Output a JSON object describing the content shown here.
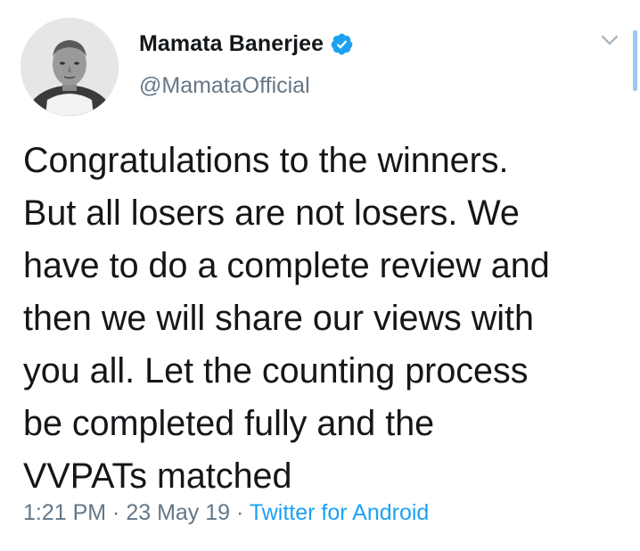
{
  "user": {
    "display_name": "Mamata Banerjee",
    "handle": "@MamataOfficial",
    "verified": true
  },
  "tweet": {
    "lines": [
      "Congratulations to the winners.",
      "But all losers are not losers. We",
      "have to do a complete review and",
      "then we will share our views with",
      "you all. Let the counting process",
      "be completed fully and the",
      "VVPATs matched"
    ]
  },
  "meta": {
    "time": "1:21 PM",
    "sep1": " · ",
    "date": "23 May 19",
    "sep2": " · ",
    "source": "Twitter for Android"
  },
  "icons": {
    "verified": "verified-badge-icon",
    "menu": "chevron-down-icon"
  },
  "colors": {
    "text": "#14171a",
    "secondary": "#657786",
    "link": "#1da1f2",
    "verified": "#1da1f2"
  }
}
